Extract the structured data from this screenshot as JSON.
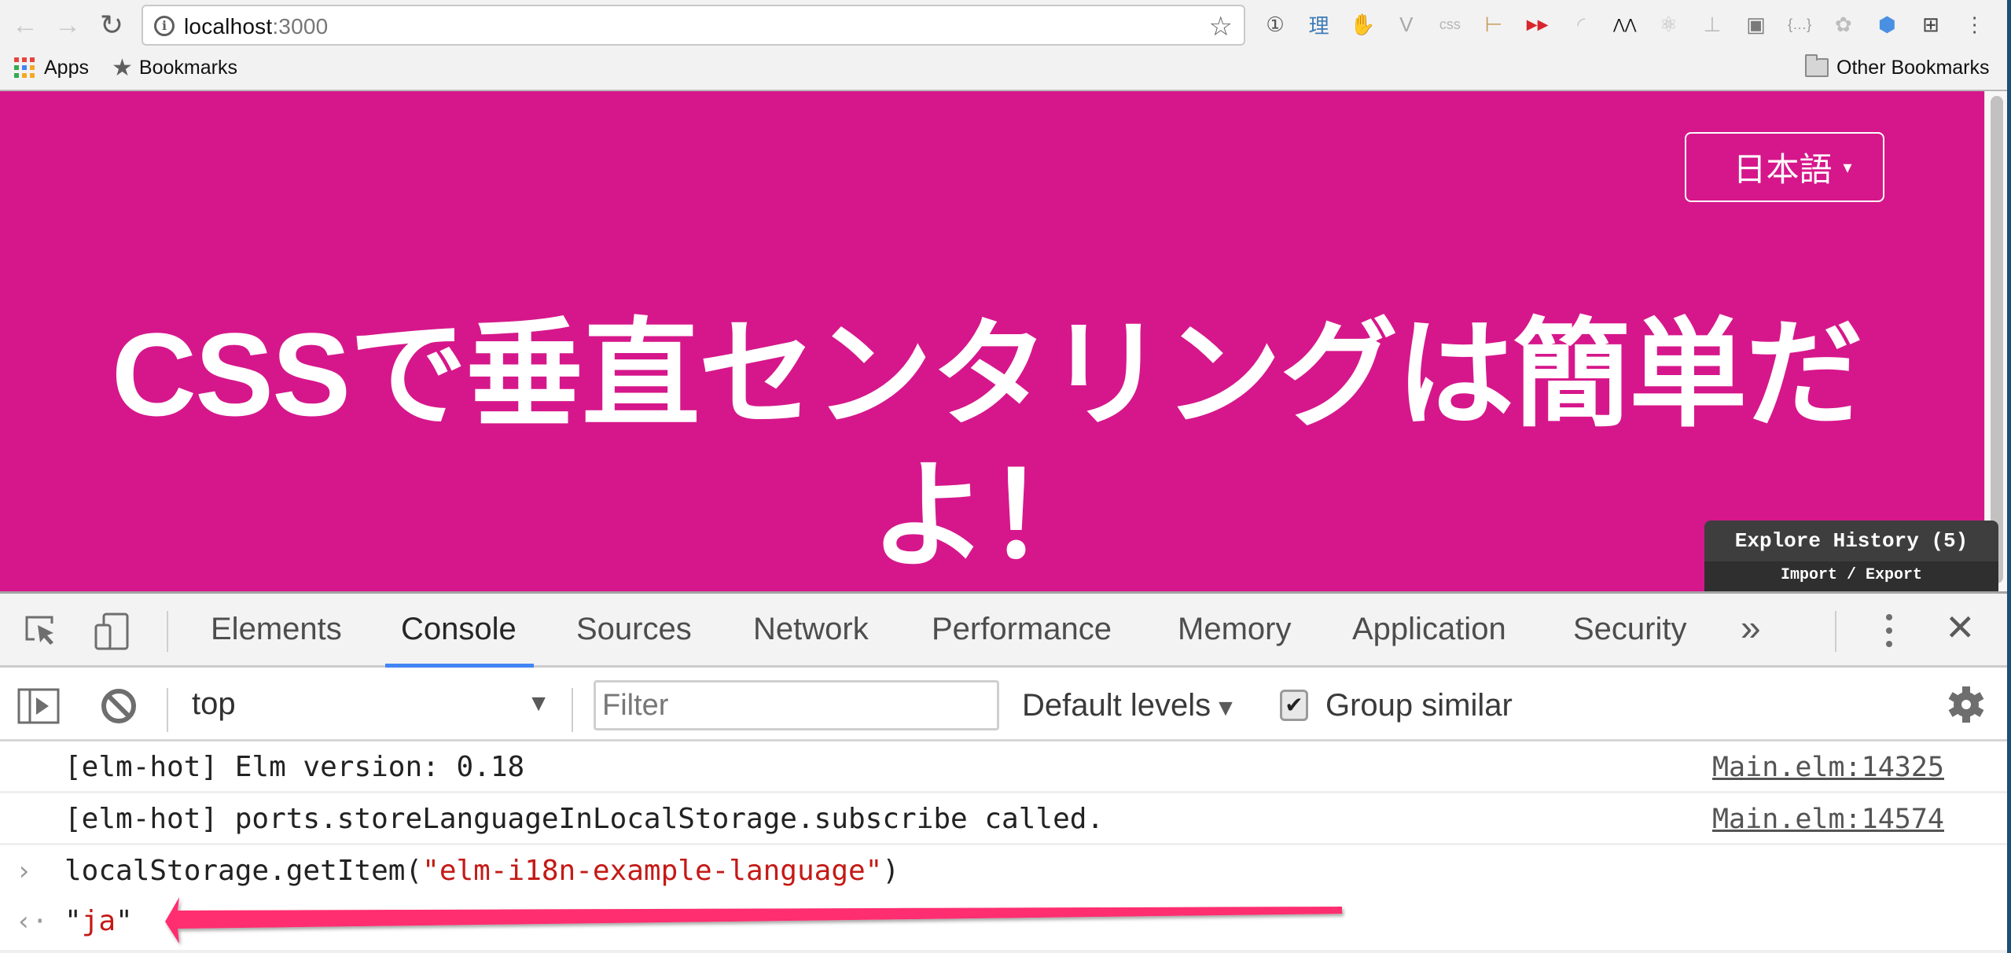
{
  "browser": {
    "url_host": "localhost",
    "url_port": ":3000",
    "nav": {
      "back": "←",
      "forward": "→",
      "reload": "↻"
    },
    "extensions": [
      {
        "name": "1password-icon",
        "glyph": "①",
        "color": "#555555"
      },
      {
        "name": "rikaikun-icon",
        "glyph": "理",
        "color": "#3f7cb8"
      },
      {
        "name": "adblock-icon",
        "glyph": "✋",
        "color": "#d8262c"
      },
      {
        "name": "vimium-icon",
        "glyph": "V",
        "color": "#a8a8a8"
      },
      {
        "name": "css-validator-icon",
        "glyph": "css",
        "color": "#b5b5b5"
      },
      {
        "name": "ruler-icon",
        "glyph": "⊢",
        "color": "#c89a5b"
      },
      {
        "name": "youtube-speed-icon",
        "glyph": "▶▶",
        "color": "#d8262c"
      },
      {
        "name": "feedly-icon",
        "glyph": "◜",
        "color": "#c8c8c8"
      },
      {
        "name": "codepen-icon",
        "glyph": "⋀⋀",
        "color": "#111111"
      },
      {
        "name": "react-devtools-icon",
        "glyph": "⚛",
        "color": "#bdbdbd"
      },
      {
        "name": "sitemap-icon",
        "glyph": "⊥",
        "color": "#bdbdbd"
      },
      {
        "name": "outlet-icon",
        "glyph": "▣",
        "color": "#7a7a7a"
      },
      {
        "name": "json-viewer-icon",
        "glyph": "{…}",
        "color": "#9a9a9a"
      },
      {
        "name": "evernote-icon",
        "glyph": "✿",
        "color": "#bdbdbd"
      },
      {
        "name": "tag-icon",
        "glyph": "⬢",
        "color": "#4a90e2"
      },
      {
        "name": "window-grid-icon",
        "glyph": "⊞",
        "color": "#444444"
      },
      {
        "name": "chrome-menu-icon",
        "glyph": "⋮",
        "color": "#555555"
      }
    ],
    "bookmarks": {
      "apps": "Apps",
      "bookmarks": "Bookmarks",
      "other": "Other Bookmarks"
    }
  },
  "page": {
    "background": "#d6178b",
    "language_selector": {
      "label": "日本語",
      "caret": "▾"
    },
    "headline": "CSSで垂直センタリングは簡単だよ！",
    "elm_debugger": {
      "explore": "Explore History (5)",
      "import_export": "Import / Export"
    }
  },
  "devtools": {
    "tabs": [
      {
        "label": "Elements",
        "active": false
      },
      {
        "label": "Console",
        "active": true
      },
      {
        "label": "Sources",
        "active": false
      },
      {
        "label": "Network",
        "active": false
      },
      {
        "label": "Performance",
        "active": false
      },
      {
        "label": "Memory",
        "active": false
      },
      {
        "label": "Application",
        "active": false
      },
      {
        "label": "Security",
        "active": false
      }
    ],
    "more_tabs": "»",
    "close": "✕",
    "accent": "#4285f4",
    "toolbar": {
      "context": "top",
      "context_arrow": "▼",
      "filter_placeholder": "Filter",
      "filter_value": "",
      "levels": "Default levels",
      "levels_arrow": "▼",
      "group_similar": "Group similar",
      "group_similar_checked": "✔"
    },
    "console": {
      "messages": [
        {
          "text": "[elm-hot] Elm version: 0.18",
          "source": "Main.elm:14325"
        },
        {
          "text": "[elm-hot] ports.storeLanguageInLocalStorage.subscribe called.",
          "source": "Main.elm:14574"
        }
      ],
      "command": {
        "prompt": "›",
        "prefix": "localStorage.getItem(",
        "argument": "\"elm-i18n-example-language\"",
        "suffix": ")"
      },
      "result": {
        "prompt": "‹·",
        "open_quote": "\"",
        "value": "ja",
        "close_quote": "\""
      }
    }
  },
  "annotation": {
    "type": "arrow",
    "color": "#ff2d6f",
    "points_to": "console-result"
  }
}
